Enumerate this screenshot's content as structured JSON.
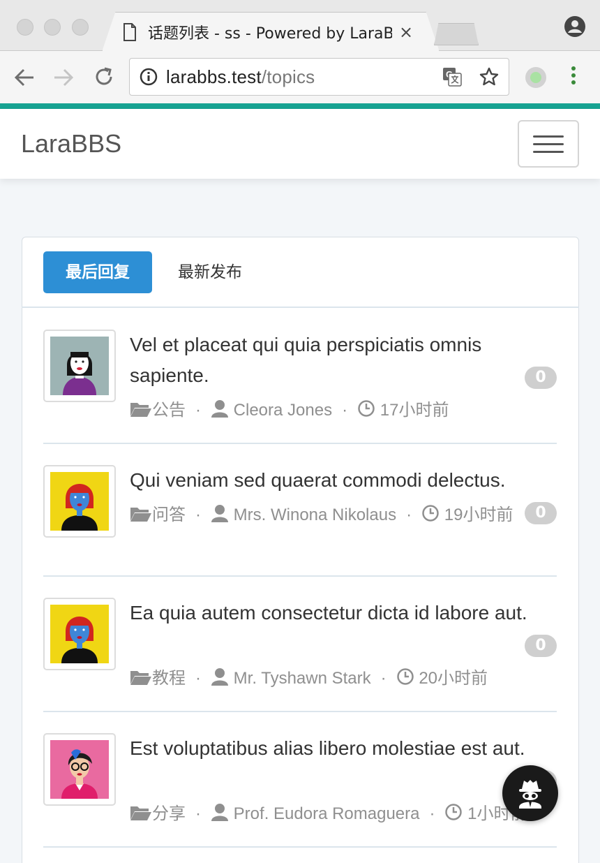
{
  "browser": {
    "tab_title": "话题列表 - ss - Powered by LaraBBS",
    "tab_close": "×",
    "url_host": "larabbs.test",
    "url_path": "/topics"
  },
  "site": {
    "brand": "LaraBBS"
  },
  "filters": {
    "active_label": "最后回复",
    "other_label": "最新发布"
  },
  "topics": [
    {
      "title": "Vel et placeat qui quia perspiciatis omnis sapiente.",
      "category": "公告",
      "author": "Cleora Jones",
      "time": "17小时前",
      "replies": "0"
    },
    {
      "title": "Qui veniam sed quaerat commodi delectus.",
      "category": "问答",
      "author": "Mrs. Winona Nikolaus",
      "time": "19小时前",
      "replies": "0"
    },
    {
      "title": "Ea quia autem consectetur dicta id labore aut.",
      "category": "教程",
      "author": "Mr. Tyshawn Stark",
      "time": "20小时前",
      "replies": "0"
    },
    {
      "title": "Est voluptatibus alias libero molestiae est aut.",
      "category": "分享",
      "author": "Prof. Eudora Romaguera",
      "time": "1小时前",
      "replies": "0"
    }
  ],
  "icons": {
    "page": "page-icon",
    "info": "info-icon",
    "translate": "translate-icon",
    "star": "star-icon",
    "folder": "folder-icon",
    "user": "user-icon",
    "clock": "clock-icon",
    "spy": "incognito-icon"
  },
  "colors": {
    "accent_line": "#17a392",
    "primary": "#2d8fd5",
    "badge": "#cfcfcf"
  }
}
